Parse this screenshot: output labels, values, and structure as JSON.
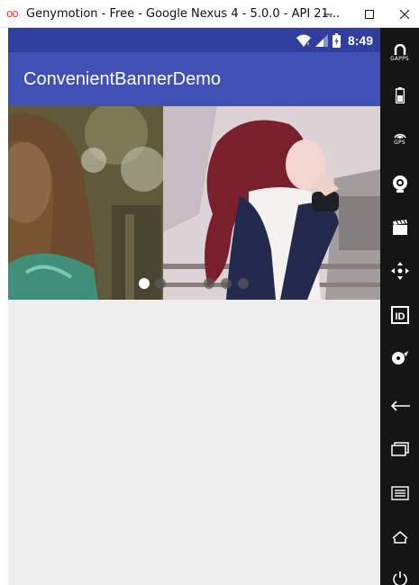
{
  "window": {
    "title": "Genymotion - Free - Google Nexus 4 - 5.0.0 - API 21...",
    "logo_text": "oo"
  },
  "phone": {
    "status_bar": {
      "time": "8:49",
      "icons": [
        "wifi-icon",
        "signal-icon",
        "battery-icon"
      ]
    },
    "app_bar": {
      "title": "ConvenientBannerDemo"
    },
    "banner": {
      "images": [
        {
          "name": "girl-with-long-hair-photo"
        },
        {
          "name": "girl-in-red-hair-photo"
        }
      ],
      "page_count": 5,
      "current_page": 0
    }
  },
  "sidebar": {
    "tools": [
      {
        "icon": "gapps-icon",
        "label": "GAPPS"
      },
      {
        "icon": "battery-icon",
        "label": ""
      },
      {
        "icon": "gps-icon",
        "label": "GPS"
      },
      {
        "icon": "camera-icon",
        "label": ""
      },
      {
        "icon": "screencast-icon",
        "label": ""
      },
      {
        "icon": "dpad-icon",
        "label": ""
      },
      {
        "icon": "id-icon",
        "label": ""
      },
      {
        "icon": "disk-icon",
        "label": ""
      },
      {
        "icon": "back-icon",
        "label": ""
      },
      {
        "icon": "recent-apps-icon",
        "label": ""
      },
      {
        "icon": "menu-icon",
        "label": ""
      },
      {
        "icon": "home-icon",
        "label": ""
      },
      {
        "icon": "power-icon",
        "label": ""
      }
    ]
  },
  "colors": {
    "status_bar": "#303f9f",
    "app_bar": "#3f51b5",
    "phone_bg": "#eeeeee",
    "sidebar_bg": "#151515"
  }
}
